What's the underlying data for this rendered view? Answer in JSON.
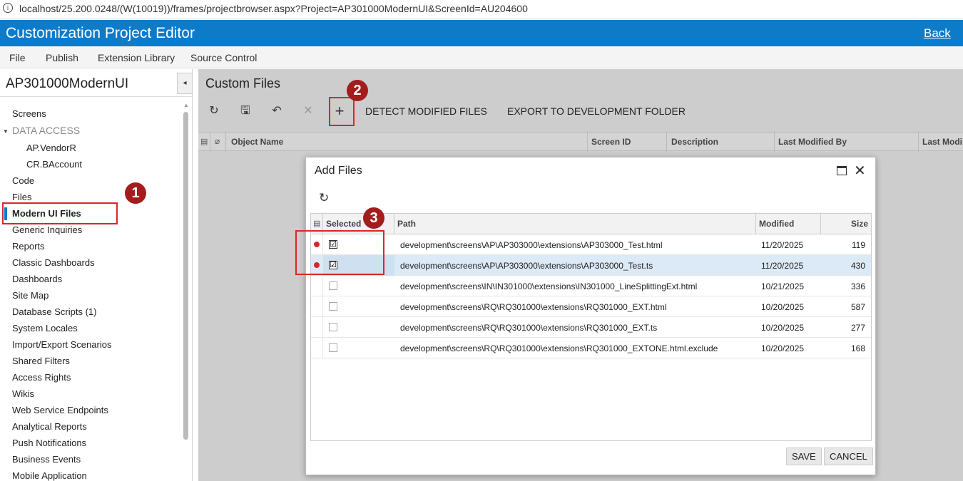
{
  "browser": {
    "info_icon": "i",
    "url": "localhost/25.200.0248/(W(10019))/frames/projectbrowser.aspx?Project=AP301000ModernUI&ScreenId=AU204600"
  },
  "header": {
    "title": "Customization Project Editor",
    "back_label": "Back",
    "accent_color": "#0e7bc9"
  },
  "menu": {
    "items": [
      "File",
      "Publish",
      "Extension Library",
      "Source Control"
    ]
  },
  "sidebar": {
    "project_name": "AP301000ModernUI",
    "collapse_icon": "◂",
    "items": [
      {
        "label": "Screens"
      },
      {
        "label": "DATA ACCESS"
      },
      {
        "label": "AP.VendorR"
      },
      {
        "label": "CR.BAccount"
      },
      {
        "label": "Code"
      },
      {
        "label": "Files"
      },
      {
        "label": "Modern UI Files"
      },
      {
        "label": "Generic Inquiries"
      },
      {
        "label": "Reports"
      },
      {
        "label": "Classic Dashboards"
      },
      {
        "label": "Dashboards"
      },
      {
        "label": "Site Map"
      },
      {
        "label": "Database Scripts (1)"
      },
      {
        "label": "System Locales"
      },
      {
        "label": "Import/Export Scenarios"
      },
      {
        "label": "Shared Filters"
      },
      {
        "label": "Access Rights"
      },
      {
        "label": "Wikis"
      },
      {
        "label": "Web Service Endpoints"
      },
      {
        "label": "Analytical Reports"
      },
      {
        "label": "Push Notifications"
      },
      {
        "label": "Business Events"
      },
      {
        "label": "Mobile Application"
      }
    ]
  },
  "main": {
    "page_title": "Custom Files",
    "toolbar": {
      "refresh_icon": "↻",
      "save_icon": "🖫",
      "undo_icon": "↶",
      "delete_icon": "✕",
      "add_icon": "+",
      "detect_label": "DETECT MODIFIED FILES",
      "export_label": "EXPORT TO DEVELOPMENT FOLDER"
    },
    "grid_columns": [
      "Object Name",
      "Screen ID",
      "Description",
      "Last Modified By",
      "Last Modi"
    ]
  },
  "annotations": {
    "badge1": "1",
    "badge2": "2",
    "badge3": "3",
    "highlight_color": "#d9262b"
  },
  "dialog": {
    "title": "Add Files",
    "refresh_icon": "↻",
    "close_icon": "✕",
    "columns": {
      "selected": "Selected",
      "path": "Path",
      "modified": "Modified",
      "size": "Size"
    },
    "rows": [
      {
        "modified_dot": true,
        "checked": "☑",
        "path": "development\\screens\\AP\\AP303000\\extensions\\AP303000_Test.html",
        "modified": "11/20/2025",
        "size": "119"
      },
      {
        "modified_dot": true,
        "checked": "☑",
        "path": "development\\screens\\AP\\AP303000\\extensions\\AP303000_Test.ts",
        "modified": "11/20/2025",
        "size": "430"
      },
      {
        "modified_dot": false,
        "checked": "",
        "path": "development\\screens\\IN\\IN301000\\extensions\\IN301000_LineSplittingExt.html",
        "modified": "10/21/2025",
        "size": "336"
      },
      {
        "modified_dot": false,
        "checked": "",
        "path": "development\\screens\\RQ\\RQ301000\\extensions\\RQ301000_EXT.html",
        "modified": "10/20/2025",
        "size": "587"
      },
      {
        "modified_dot": false,
        "checked": "",
        "path": "development\\screens\\RQ\\RQ301000\\extensions\\RQ301000_EXT.ts",
        "modified": "10/20/2025",
        "size": "277"
      },
      {
        "modified_dot": false,
        "checked": "",
        "path": "development\\screens\\RQ\\RQ301000\\extensions\\RQ301000_EXTONE.html.exclude",
        "modified": "10/20/2025",
        "size": "168"
      }
    ],
    "save_label": "SAVE",
    "cancel_label": "CANCEL"
  }
}
